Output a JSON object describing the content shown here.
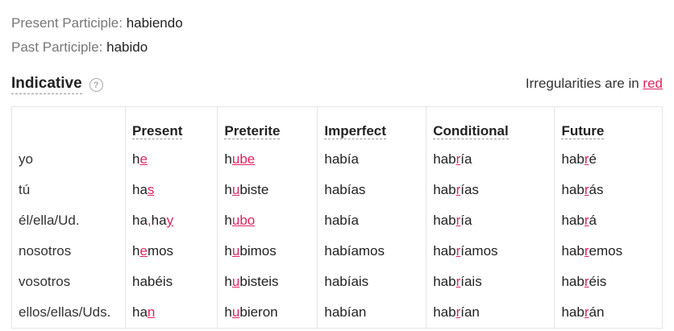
{
  "participles": {
    "present_label": "Present Participle:",
    "present_value": "habiendo",
    "past_label": "Past Participle:",
    "past_value": "habido"
  },
  "section": {
    "title": "Indicative",
    "help_icon": "question-circle-icon",
    "note_prefix": "Irregularities are in ",
    "note_link": "red"
  },
  "colors": {
    "irregular": "#e0245e"
  },
  "table": {
    "columns": [
      "Present",
      "Preterite",
      "Imperfect",
      "Conditional",
      "Future"
    ],
    "rows": [
      {
        "pronoun": "yo",
        "cells": [
          [
            [
              "h",
              false
            ],
            [
              "e",
              true
            ]
          ],
          [
            [
              "h",
              false
            ],
            [
              "ube",
              true
            ]
          ],
          [
            [
              "había",
              false
            ]
          ],
          [
            [
              "hab",
              false
            ],
            [
              "r",
              true
            ],
            [
              "ía",
              false
            ]
          ],
          [
            [
              "hab",
              false
            ],
            [
              "r",
              true
            ],
            [
              "é",
              false
            ]
          ]
        ]
      },
      {
        "pronoun": "tú",
        "cells": [
          [
            [
              "ha",
              false
            ],
            [
              "s",
              true
            ]
          ],
          [
            [
              "h",
              false
            ],
            [
              "u",
              true
            ],
            [
              "biste",
              false
            ]
          ],
          [
            [
              "habías",
              false
            ]
          ],
          [
            [
              "hab",
              false
            ],
            [
              "r",
              true
            ],
            [
              "ías",
              false
            ]
          ],
          [
            [
              "hab",
              false
            ],
            [
              "r",
              true
            ],
            [
              "ás",
              false
            ]
          ]
        ]
      },
      {
        "pronoun": "él/ella/Ud.",
        "cells": [
          [
            [
              "ha",
              false
            ],
            [
              ",",
              true
            ],
            [
              "ha",
              false
            ],
            [
              "y",
              true
            ]
          ],
          [
            [
              "h",
              false
            ],
            [
              "ubo",
              true
            ]
          ],
          [
            [
              "había",
              false
            ]
          ],
          [
            [
              "hab",
              false
            ],
            [
              "r",
              true
            ],
            [
              "ía",
              false
            ]
          ],
          [
            [
              "hab",
              false
            ],
            [
              "r",
              true
            ],
            [
              "á",
              false
            ]
          ]
        ]
      },
      {
        "pronoun": "nosotros",
        "cells": [
          [
            [
              "h",
              false
            ],
            [
              "e",
              true
            ],
            [
              "mos",
              false
            ]
          ],
          [
            [
              "h",
              false
            ],
            [
              "u",
              true
            ],
            [
              "bimos",
              false
            ]
          ],
          [
            [
              "habíamos",
              false
            ]
          ],
          [
            [
              "hab",
              false
            ],
            [
              "r",
              true
            ],
            [
              "íamos",
              false
            ]
          ],
          [
            [
              "hab",
              false
            ],
            [
              "r",
              true
            ],
            [
              "emos",
              false
            ]
          ]
        ]
      },
      {
        "pronoun": "vosotros",
        "cells": [
          [
            [
              "habéis",
              false
            ]
          ],
          [
            [
              "h",
              false
            ],
            [
              "u",
              true
            ],
            [
              "bisteis",
              false
            ]
          ],
          [
            [
              "habíais",
              false
            ]
          ],
          [
            [
              "hab",
              false
            ],
            [
              "r",
              true
            ],
            [
              "íais",
              false
            ]
          ],
          [
            [
              "hab",
              false
            ],
            [
              "r",
              true
            ],
            [
              "éis",
              false
            ]
          ]
        ]
      },
      {
        "pronoun": "ellos/ellas/Uds.",
        "cells": [
          [
            [
              "ha",
              false
            ],
            [
              "n",
              true
            ]
          ],
          [
            [
              "h",
              false
            ],
            [
              "u",
              true
            ],
            [
              "bieron",
              false
            ]
          ],
          [
            [
              "habían",
              false
            ]
          ],
          [
            [
              "hab",
              false
            ],
            [
              "r",
              true
            ],
            [
              "ían",
              false
            ]
          ],
          [
            [
              "hab",
              false
            ],
            [
              "r",
              true
            ],
            [
              "án",
              false
            ]
          ]
        ]
      }
    ]
  }
}
